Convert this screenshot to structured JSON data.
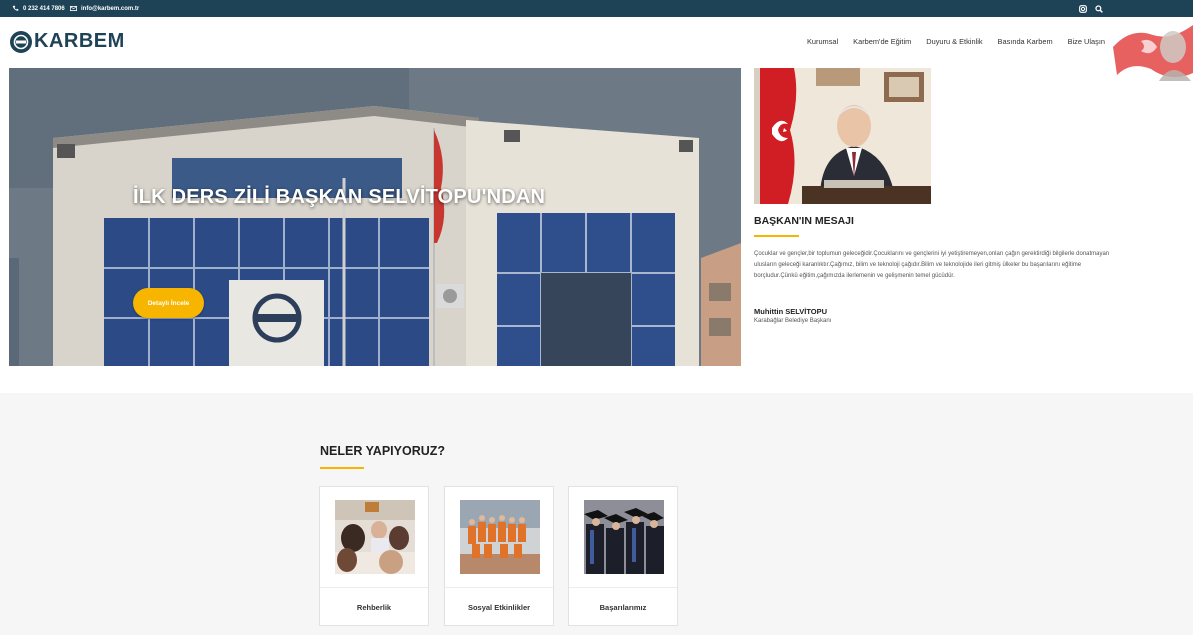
{
  "topbar": {
    "phone": "0 232 414 7806",
    "email": "info@karbem.com.tr",
    "icons": [
      "phone-icon",
      "mail-icon",
      "instagram-icon",
      "search-icon"
    ]
  },
  "header": {
    "logo_text": "KARBEM",
    "nav": [
      "Kurumsal",
      "Karbem'de Eğitim",
      "Duyuru & Etkinlik",
      "Basında Karbem",
      "Bize Ulaşın"
    ]
  },
  "hero": {
    "title": "İLK DERS ZİLİ BAŞKAN SELVİTOPU'NDAN",
    "button": "Detaylı İncele"
  },
  "mayor": {
    "title": "BAŞKAN'IN MESAJI",
    "message": "Çocuklar ve gençler,bir toplumun geleceğidir.Çocuklarını ve gençlerini iyi yetiştiremeyen,onları çağın gerektirdiği bilgilerle donatmayan ulusların geleceği karanlıktır.Çağımız, bilim ve teknoloji çağıdır.Bilim ve teknolojide ileri gitmiş ülkeler bu başarılarını eğitime borçludur.Çünkü eğitim,çağımızda ilerlemenin ve gelişmenin temel gücüdür.",
    "name": "Muhittin SELVİTOPU",
    "role": "Karabağlar Belediye Başkanı"
  },
  "section": {
    "title": "NELER YAPIYORUZ?",
    "cards": [
      "Rehberlik",
      "Sosyal Etkinlikler",
      "Başarılarımız"
    ]
  },
  "colors": {
    "topbar": "#1f4356",
    "accent": "#f7b500"
  }
}
